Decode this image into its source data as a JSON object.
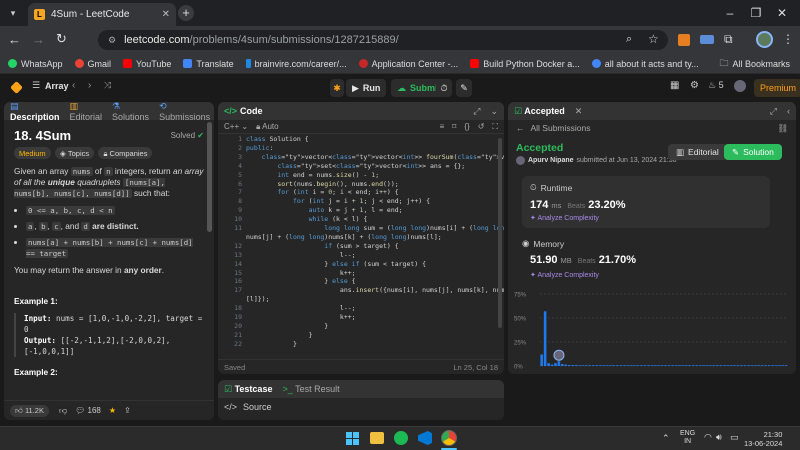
{
  "browser": {
    "tab_title": "4Sum - LeetCode",
    "url_domain": "leetcode.com",
    "url_path": "/problems/4sum/submissions/1287215889/",
    "bookmarks": [
      {
        "label": "WhatsApp",
        "color": "#25d366"
      },
      {
        "label": "Gmail",
        "color": "#ea4335"
      },
      {
        "label": "YouTube",
        "color": "#ff0000"
      },
      {
        "label": "Translate",
        "color": "#4285f4"
      },
      {
        "label": "brainvire.com/career/...",
        "color": "#1e88e5"
      },
      {
        "label": "Application Center -...",
        "color": "#c62828"
      },
      {
        "label": "Build Python Docker a...",
        "color": "#ff0000"
      },
      {
        "label": "all about it acts and ty...",
        "color": "#4285f4"
      }
    ],
    "all_bookmarks": "All Bookmarks"
  },
  "nav": {
    "list_label": "Array",
    "run": "Run",
    "submit": "Submit",
    "streak": "5",
    "premium": "Premium"
  },
  "description": {
    "tabs": [
      "Description",
      "Editorial",
      "Solutions",
      "Submissions"
    ],
    "title": "18. 4Sum",
    "solved": "Solved",
    "difficulty": "Medium",
    "topics": "Topics",
    "companies": "Companies",
    "p1_a": "Given an array",
    "p1_code": "nums",
    "p1_b": "of",
    "p1_c": "n",
    "p1_d": "integers, return",
    "p1_e": "an array of all the",
    "p1_f": "unique",
    "p1_g": "quadruplets",
    "p1_h": "[nums[a], nums[b], nums[c], nums[d]]",
    "p1_i": "such that:",
    "bullet1": "0 <= a, b, c, d < n",
    "bullet2_a": "a",
    "bullet2_b": "b",
    "bullet2_c": "c",
    "bullet2_d": "d",
    "bullet2_txt": "and",
    "bullet2_end": "are distinct.",
    "bullet3": "nums[a] + nums[b] + nums[c] + nums[d] == target",
    "p2_a": "You may return the answer in",
    "p2_b": "any order",
    "ex1": "Example 1:",
    "ex1_input_l": "Input:",
    "ex1_input": "nums = [1,0,-1,0,-2,2], target = 0",
    "ex1_output_l": "Output:",
    "ex1_output": "[[-2,-1,1,2],[-2,0,0,2],[-1,0,0,1]]",
    "ex2": "Example 2:",
    "likes": "11.2K",
    "comments": "168"
  },
  "code": {
    "tab": "Code",
    "lang": "C++",
    "mode": "Auto",
    "status_left": "Saved",
    "status_right": "Ln 25, Col 18",
    "line_numbers": [
      "1",
      "2",
      "3",
      "4",
      "5",
      "6",
      "7",
      "8",
      "9",
      "10",
      "11",
      "",
      "12",
      "13",
      "14",
      "15",
      "16",
      "17",
      "",
      "18",
      "19",
      "20",
      "21",
      "22"
    ],
    "lines": [
      "class Solution {",
      "public:",
      "    vector<vector<int>> fourSum(vector<int>& nums, int target) {",
      "        set<vector<int>> ans = {};",
      "        int end = nums.size() - 1;",
      "        sort(nums.begin(), nums.end());",
      "        for (int i = 0; i < end; i++) {",
      "            for (int j = i + 1; j < end; j++) {",
      "                auto k = j + 1, l = end;",
      "                while (k < l) {",
      "                    long long sum = (long long)nums[i] + (long long)",
      "nums[j] + (long long)nums[k] + (long long)nums[l];",
      "                    if (sum > target) {",
      "                        l--;",
      "                    } else if (sum < target) {",
      "                        k++;",
      "                    } else {",
      "                        ans.insert({nums[i], nums[j], nums[k], nums",
      "[l]});",
      "                        l--;",
      "                        k++;",
      "                    }",
      "                }",
      "            }"
    ]
  },
  "testcase": {
    "tab1": "Testcase",
    "tab2": "Test Result",
    "source": "Source"
  },
  "accepted": {
    "tab": "Accepted",
    "back": "All Submissions",
    "status": "Accepted",
    "user": "Apurv Nipane",
    "submitted": "submitted at Jun 13, 2024 21:30",
    "editorial": "Editorial",
    "solution": "Solution",
    "runtime_label": "Runtime",
    "runtime_value": "174",
    "runtime_unit": "ms",
    "runtime_beats_l": "Beats",
    "runtime_beats": "23.20%",
    "analyze": "Analyze Complexity",
    "memory_label": "Memory",
    "memory_value": "51.90",
    "memory_unit": "MB",
    "memory_beats_l": "Beats",
    "memory_beats": "21.70%",
    "analyze2": "Analyze Complexity",
    "y_ticks": [
      "75%",
      "50%",
      "25%",
      "0%"
    ]
  },
  "chart_data": {
    "type": "bar",
    "y_ticks": [
      "75%",
      "50%",
      "25%",
      "0%"
    ],
    "ylim": [
      0,
      75
    ],
    "values": [
      12,
      57,
      3,
      1.5,
      3,
      5,
      2,
      1.5,
      1,
      1,
      1,
      0.8,
      0.8,
      0.8,
      0.8,
      0.8,
      0.8,
      0.8,
      0.8,
      0.8,
      0.8,
      0.8,
      0.8,
      0.8,
      0.8,
      0.8,
      0.8,
      0.8,
      0.8,
      0.8,
      0.8,
      0.8,
      0.8,
      0.8,
      0.8,
      0.8,
      0.8,
      0.8,
      0.8,
      0.8,
      0.8,
      0.8,
      0.8,
      0.8,
      0.8,
      0.8,
      0.8,
      0.8,
      0.8,
      0.8,
      0.8,
      0.8,
      0.8,
      0.8,
      0.8,
      0.8,
      0.8,
      0.8,
      0.8,
      0.8,
      0.8,
      0.8,
      0.8,
      0.8,
      0.8,
      0.8,
      0.8,
      0.8,
      0.8,
      0.8,
      0.8,
      0.8
    ],
    "bar_color": "#1f7af0"
  },
  "taskbar": {
    "lang": "ENG",
    "region": "IN",
    "time": "21:30",
    "date": "13-06-2024"
  }
}
